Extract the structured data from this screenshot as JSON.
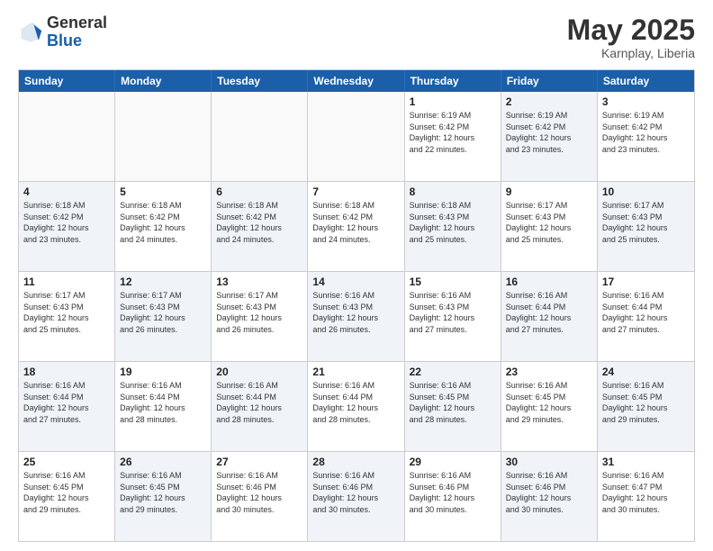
{
  "header": {
    "logo_general": "General",
    "logo_blue": "Blue",
    "month_year": "May 2025",
    "location": "Karnplay, Liberia"
  },
  "calendar": {
    "days_of_week": [
      "Sunday",
      "Monday",
      "Tuesday",
      "Wednesday",
      "Thursday",
      "Friday",
      "Saturday"
    ],
    "rows": [
      [
        {
          "day": "",
          "info": "",
          "empty": true
        },
        {
          "day": "",
          "info": "",
          "empty": true
        },
        {
          "day": "",
          "info": "",
          "empty": true
        },
        {
          "day": "",
          "info": "",
          "empty": true
        },
        {
          "day": "1",
          "info": "Sunrise: 6:19 AM\nSunset: 6:42 PM\nDaylight: 12 hours\nand 22 minutes.",
          "shaded": false
        },
        {
          "day": "2",
          "info": "Sunrise: 6:19 AM\nSunset: 6:42 PM\nDaylight: 12 hours\nand 23 minutes.",
          "shaded": true
        },
        {
          "day": "3",
          "info": "Sunrise: 6:19 AM\nSunset: 6:42 PM\nDaylight: 12 hours\nand 23 minutes.",
          "shaded": false
        }
      ],
      [
        {
          "day": "4",
          "info": "Sunrise: 6:18 AM\nSunset: 6:42 PM\nDaylight: 12 hours\nand 23 minutes.",
          "shaded": true
        },
        {
          "day": "5",
          "info": "Sunrise: 6:18 AM\nSunset: 6:42 PM\nDaylight: 12 hours\nand 24 minutes.",
          "shaded": false
        },
        {
          "day": "6",
          "info": "Sunrise: 6:18 AM\nSunset: 6:42 PM\nDaylight: 12 hours\nand 24 minutes.",
          "shaded": true
        },
        {
          "day": "7",
          "info": "Sunrise: 6:18 AM\nSunset: 6:42 PM\nDaylight: 12 hours\nand 24 minutes.",
          "shaded": false
        },
        {
          "day": "8",
          "info": "Sunrise: 6:18 AM\nSunset: 6:43 PM\nDaylight: 12 hours\nand 25 minutes.",
          "shaded": true
        },
        {
          "day": "9",
          "info": "Sunrise: 6:17 AM\nSunset: 6:43 PM\nDaylight: 12 hours\nand 25 minutes.",
          "shaded": false
        },
        {
          "day": "10",
          "info": "Sunrise: 6:17 AM\nSunset: 6:43 PM\nDaylight: 12 hours\nand 25 minutes.",
          "shaded": true
        }
      ],
      [
        {
          "day": "11",
          "info": "Sunrise: 6:17 AM\nSunset: 6:43 PM\nDaylight: 12 hours\nand 25 minutes.",
          "shaded": false
        },
        {
          "day": "12",
          "info": "Sunrise: 6:17 AM\nSunset: 6:43 PM\nDaylight: 12 hours\nand 26 minutes.",
          "shaded": true
        },
        {
          "day": "13",
          "info": "Sunrise: 6:17 AM\nSunset: 6:43 PM\nDaylight: 12 hours\nand 26 minutes.",
          "shaded": false
        },
        {
          "day": "14",
          "info": "Sunrise: 6:16 AM\nSunset: 6:43 PM\nDaylight: 12 hours\nand 26 minutes.",
          "shaded": true
        },
        {
          "day": "15",
          "info": "Sunrise: 6:16 AM\nSunset: 6:43 PM\nDaylight: 12 hours\nand 27 minutes.",
          "shaded": false
        },
        {
          "day": "16",
          "info": "Sunrise: 6:16 AM\nSunset: 6:44 PM\nDaylight: 12 hours\nand 27 minutes.",
          "shaded": true
        },
        {
          "day": "17",
          "info": "Sunrise: 6:16 AM\nSunset: 6:44 PM\nDaylight: 12 hours\nand 27 minutes.",
          "shaded": false
        }
      ],
      [
        {
          "day": "18",
          "info": "Sunrise: 6:16 AM\nSunset: 6:44 PM\nDaylight: 12 hours\nand 27 minutes.",
          "shaded": true
        },
        {
          "day": "19",
          "info": "Sunrise: 6:16 AM\nSunset: 6:44 PM\nDaylight: 12 hours\nand 28 minutes.",
          "shaded": false
        },
        {
          "day": "20",
          "info": "Sunrise: 6:16 AM\nSunset: 6:44 PM\nDaylight: 12 hours\nand 28 minutes.",
          "shaded": true
        },
        {
          "day": "21",
          "info": "Sunrise: 6:16 AM\nSunset: 6:44 PM\nDaylight: 12 hours\nand 28 minutes.",
          "shaded": false
        },
        {
          "day": "22",
          "info": "Sunrise: 6:16 AM\nSunset: 6:45 PM\nDaylight: 12 hours\nand 28 minutes.",
          "shaded": true
        },
        {
          "day": "23",
          "info": "Sunrise: 6:16 AM\nSunset: 6:45 PM\nDaylight: 12 hours\nand 29 minutes.",
          "shaded": false
        },
        {
          "day": "24",
          "info": "Sunrise: 6:16 AM\nSunset: 6:45 PM\nDaylight: 12 hours\nand 29 minutes.",
          "shaded": true
        }
      ],
      [
        {
          "day": "25",
          "info": "Sunrise: 6:16 AM\nSunset: 6:45 PM\nDaylight: 12 hours\nand 29 minutes.",
          "shaded": false
        },
        {
          "day": "26",
          "info": "Sunrise: 6:16 AM\nSunset: 6:45 PM\nDaylight: 12 hours\nand 29 minutes.",
          "shaded": true
        },
        {
          "day": "27",
          "info": "Sunrise: 6:16 AM\nSunset: 6:46 PM\nDaylight: 12 hours\nand 30 minutes.",
          "shaded": false
        },
        {
          "day": "28",
          "info": "Sunrise: 6:16 AM\nSunset: 6:46 PM\nDaylight: 12 hours\nand 30 minutes.",
          "shaded": true
        },
        {
          "day": "29",
          "info": "Sunrise: 6:16 AM\nSunset: 6:46 PM\nDaylight: 12 hours\nand 30 minutes.",
          "shaded": false
        },
        {
          "day": "30",
          "info": "Sunrise: 6:16 AM\nSunset: 6:46 PM\nDaylight: 12 hours\nand 30 minutes.",
          "shaded": true
        },
        {
          "day": "31",
          "info": "Sunrise: 6:16 AM\nSunset: 6:47 PM\nDaylight: 12 hours\nand 30 minutes.",
          "shaded": false
        }
      ]
    ]
  }
}
